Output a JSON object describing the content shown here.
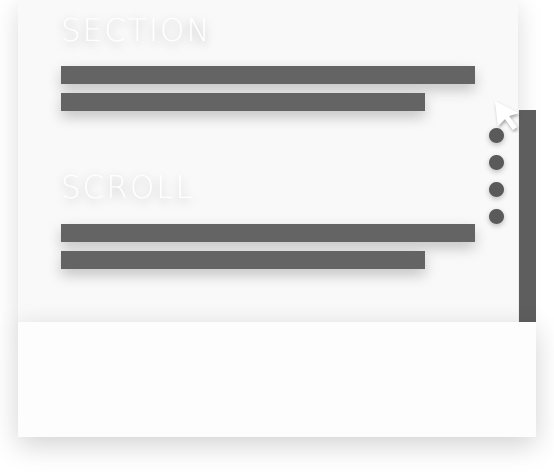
{
  "sections": [
    {
      "heading": "SECTION"
    },
    {
      "heading": "SCROLL"
    }
  ],
  "colors": {
    "bar": "#646464",
    "rail": "#5e5e5e",
    "dot": "#5a5a5a",
    "background": "#f9f9f9"
  },
  "icons": {
    "cursor": "cursor-arrow-icon",
    "nav_dots": "dot-icon"
  }
}
